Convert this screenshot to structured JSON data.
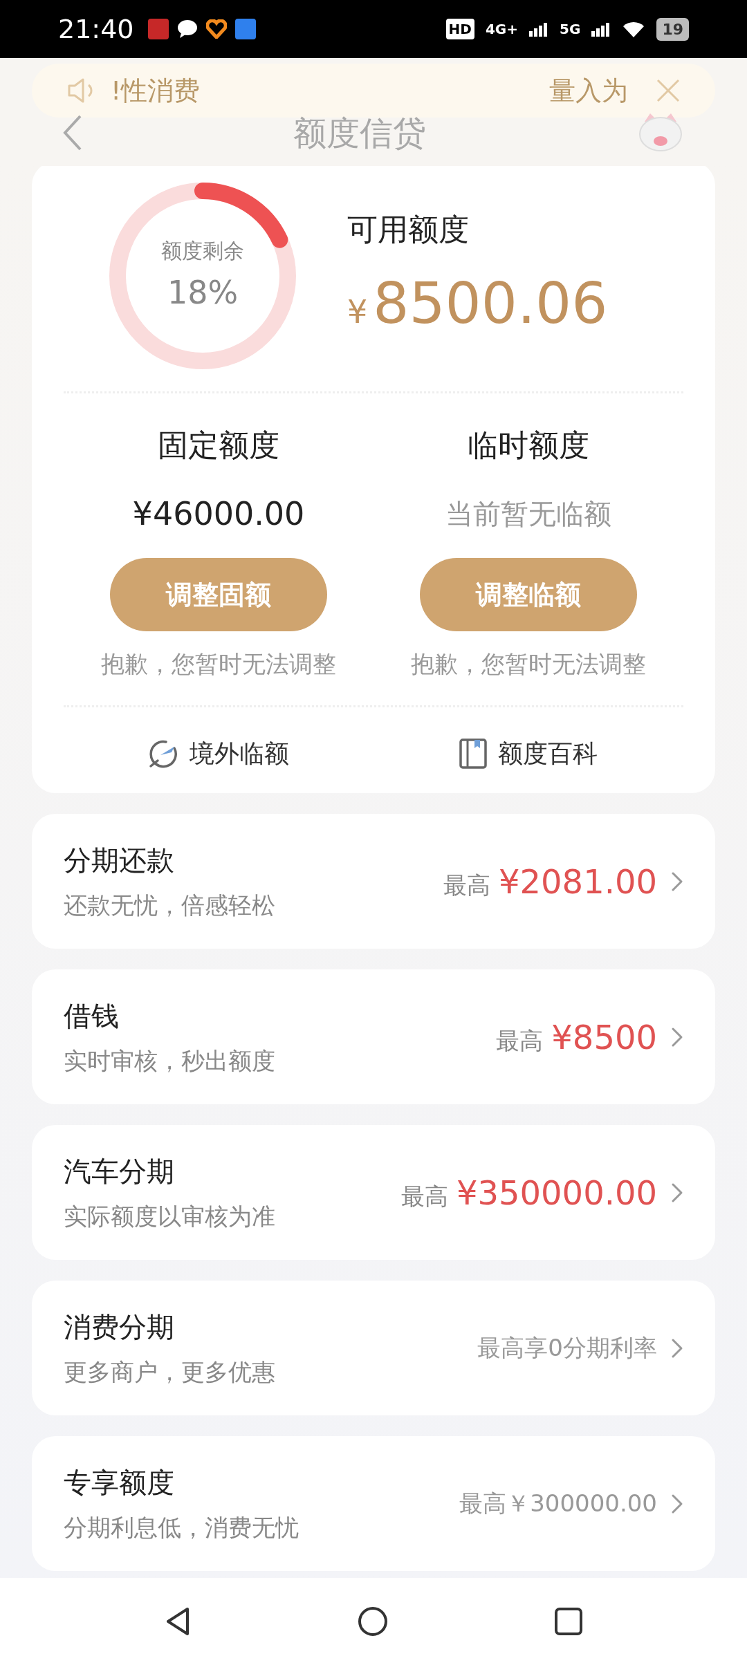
{
  "status_bar": {
    "time": "21:40",
    "hd": "HD",
    "network_1": "4G+",
    "network_2": "5G",
    "battery": "19"
  },
  "notice": {
    "left_text": "!性消费",
    "right_text": "量入为"
  },
  "header": {
    "title": "额度信贷"
  },
  "summary": {
    "ring_label": "额度剩余",
    "ring_percent": "18%",
    "level": 0.18,
    "available_label": "可用额度",
    "currency": "¥",
    "available_amount": "8500.06"
  },
  "limits": [
    {
      "title": "固定额度",
      "value": "¥46000.00",
      "kind": "amount",
      "button": "调整固额",
      "note": "抱歉，您暂时无法调整"
    },
    {
      "title": "临时额度",
      "value": "当前暂无临额",
      "kind": "hint",
      "button": "调整临额",
      "note": "抱歉，您暂时无法调整"
    }
  ],
  "links": [
    {
      "kind": "plane",
      "label": "境外临额"
    },
    {
      "kind": "book",
      "label": "额度百科"
    }
  ],
  "products": [
    {
      "title": "分期还款",
      "subtitle": "还款无忧，倍感轻松",
      "kind": "amount",
      "prefix": "最高",
      "value": "¥2081.00"
    },
    {
      "title": "借钱",
      "subtitle": "实时审核，秒出额度",
      "kind": "amount",
      "prefix": "最高",
      "value": "¥8500"
    },
    {
      "title": "汽车分期",
      "subtitle": "实际额度以审核为准",
      "kind": "amount",
      "prefix": "最高",
      "value": "¥350000.00"
    },
    {
      "title": "消费分期",
      "subtitle": "更多商户，更多优惠",
      "kind": "text",
      "value": "最高享0分期利率"
    },
    {
      "title": "专享额度",
      "subtitle": "分期利息低，消费无忧",
      "kind": "text",
      "value": "最高￥300000.00"
    }
  ]
}
